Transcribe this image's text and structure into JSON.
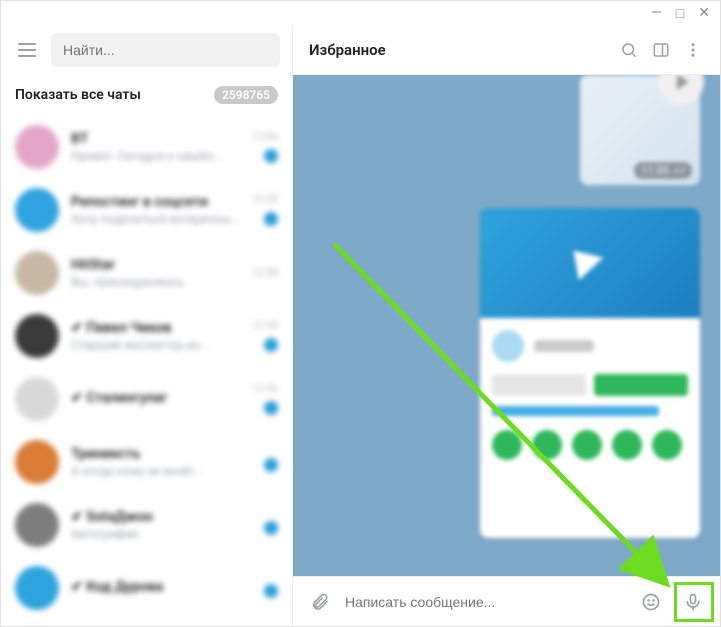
{
  "window_controls": {
    "minimize": "—",
    "maximize": "□",
    "close": "✕"
  },
  "sidebar": {
    "search_placeholder": "Найти...",
    "section_label": "Показать все чаты",
    "section_count": "2598765",
    "chats": [
      {
        "name": "ВТ",
        "snippet": "Привет. Сегодня я нашёл...",
        "time": "13:06",
        "unread": true,
        "avatar_bg": "#e3a6c8"
      },
      {
        "name": "Репостинг в соцсети",
        "snippet": "Хочу поделиться интересны...",
        "time": "12:59",
        "unread": true,
        "avatar_bg": "#2fa3dd"
      },
      {
        "name": "HitStar",
        "snippet": "Вы: присоединяюсь",
        "time": "12:58",
        "unread": false,
        "avatar_bg": "#c7b8a3"
      },
      {
        "name": "✔ Павел Чиков",
        "snippet": "Старший инспектор ин...",
        "time": "12:58",
        "unread": true,
        "avatar_bg": "#3a3a3a"
      },
      {
        "name": "✔ Сталингулаг",
        "snippet": "",
        "time": "12:56",
        "unread": true,
        "avatar_bg": "#d8d8d8"
      },
      {
        "name": "Триниксть",
        "snippet": "А когда кому не везёт...",
        "time": "",
        "unread": true,
        "avatar_bg": "#d97c36"
      },
      {
        "name": "✔ SotaДжон",
        "snippet": "Автография",
        "time": "",
        "unread": true,
        "avatar_bg": "#7d7d7d"
      },
      {
        "name": "✔ Код Дурова",
        "snippet": "",
        "time": "",
        "unread": true,
        "avatar_bg": "#2fa3dd"
      }
    ]
  },
  "chat": {
    "title": "Избранное",
    "video_message": {
      "timestamp": "11:35"
    },
    "composer": {
      "placeholder": "Написать сообщение...",
      "attach_name": "attachment-icon",
      "emoji_name": "emoji-icon",
      "mic_name": "microphone-icon"
    }
  },
  "colors": {
    "accent": "#2fa3dd",
    "highlight": "#6ddb1f",
    "chat_bg": "#7fa9c8"
  }
}
